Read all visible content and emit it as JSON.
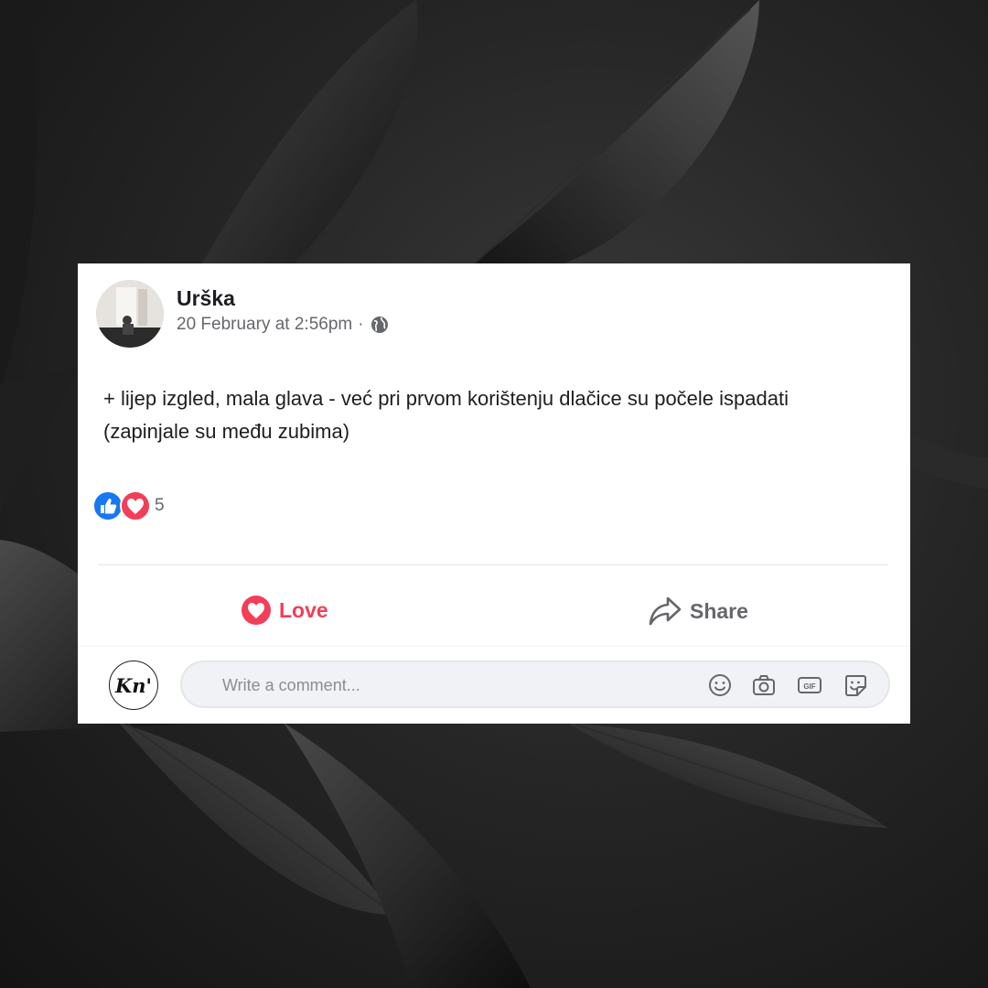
{
  "post": {
    "author": "Urška",
    "timestamp": "20 February at 2:56pm",
    "separator": "·",
    "audience_icon": "globe-icon",
    "text": "+ lijep izgled, mala glava - već pri prvom korištenju dlačice su počele ispadati (zapinjale su među zubima)"
  },
  "reactions": {
    "icons": [
      "like-reaction-icon",
      "love-reaction-icon"
    ],
    "count": "5"
  },
  "actions": {
    "love_label": "Love",
    "share_label": "Share"
  },
  "comment": {
    "avatar_text": "Kn'",
    "placeholder": "Write a comment...",
    "tool_icons": [
      "emoji-icon",
      "camera-icon",
      "gif-icon",
      "sticker-icon"
    ]
  },
  "colors": {
    "love": "#f33e58",
    "like": "#1877f2",
    "secondary_text": "#65676b",
    "background": "#262626"
  }
}
